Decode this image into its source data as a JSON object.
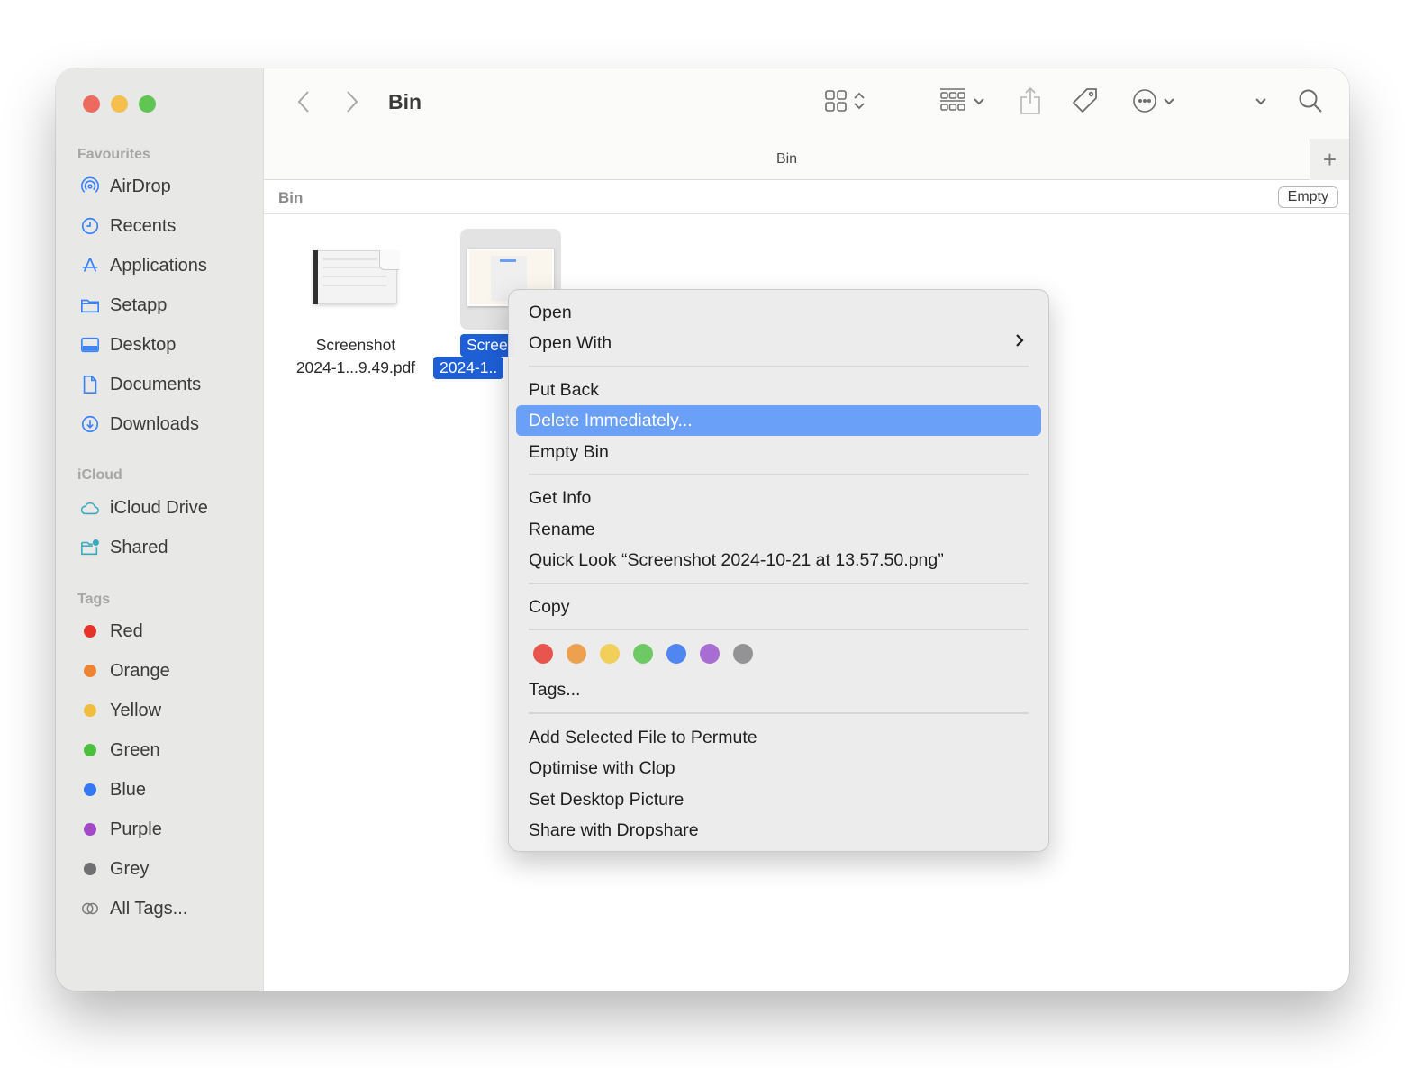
{
  "window": {
    "title": "Bin"
  },
  "sidebar": {
    "sections": [
      {
        "title": "Favourites"
      },
      {
        "title": "iCloud"
      },
      {
        "title": "Tags"
      }
    ],
    "favourites": [
      {
        "label": "AirDrop",
        "icon": "airdrop-icon"
      },
      {
        "label": "Recents",
        "icon": "clock-icon"
      },
      {
        "label": "Applications",
        "icon": "applications-icon"
      },
      {
        "label": "Setapp",
        "icon": "folder-icon"
      },
      {
        "label": "Desktop",
        "icon": "desktop-icon"
      },
      {
        "label": "Documents",
        "icon": "document-icon"
      },
      {
        "label": "Downloads",
        "icon": "download-icon"
      }
    ],
    "icloud": [
      {
        "label": "iCloud Drive",
        "icon": "cloud-icon"
      },
      {
        "label": "Shared",
        "icon": "shared-folder-icon"
      }
    ],
    "tags": [
      {
        "label": "Red",
        "color": "#e5332a"
      },
      {
        "label": "Orange",
        "color": "#ee8433"
      },
      {
        "label": "Yellow",
        "color": "#f0bd3e"
      },
      {
        "label": "Green",
        "color": "#4cbf3f"
      },
      {
        "label": "Blue",
        "color": "#3478f6"
      },
      {
        "label": "Purple",
        "color": "#a14ac8"
      },
      {
        "label": "Grey",
        "color": "#707074"
      },
      {
        "label": "All Tags...",
        "color": null
      }
    ]
  },
  "toolbar": {
    "title": "Bin",
    "icons": [
      "back-icon",
      "forward-icon",
      "icon-view-icon",
      "group-icon",
      "share-icon",
      "tag-icon",
      "more-icon",
      "expand-chevron-icon",
      "search-icon"
    ]
  },
  "tabbar": {
    "tab_label": "Bin",
    "add_tab": "+"
  },
  "pathbar": {
    "label": "Bin",
    "empty_button": "Empty"
  },
  "files": [
    {
      "line1": "Screenshot",
      "line2": "2024-1...9.49.pdf",
      "selected": false
    },
    {
      "line1": "Scree",
      "line2": "2024-1..",
      "selected": true
    }
  ],
  "context_menu": {
    "groups": [
      [
        {
          "label": "Open"
        },
        {
          "label": "Open With",
          "submenu": true
        }
      ],
      [
        {
          "label": "Put Back"
        },
        {
          "label": "Delete Immediately...",
          "highlighted": true
        },
        {
          "label": "Empty Bin"
        }
      ],
      [
        {
          "label": "Get Info"
        },
        {
          "label": "Rename"
        },
        {
          "label": "Quick Look “Screenshot 2024-10-21 at 13.57.50.png”"
        }
      ],
      [
        {
          "label": "Copy"
        }
      ],
      [
        {
          "label": "Tags..."
        }
      ],
      [
        {
          "label": "Add Selected File to Permute"
        },
        {
          "label": "Optimise with Clop"
        },
        {
          "label": "Set Desktop Picture"
        },
        {
          "label": "Share with Dropshare"
        }
      ]
    ],
    "tag_colors": [
      {
        "name": "red",
        "color": "#e8554c"
      },
      {
        "name": "orange",
        "color": "#eda04e"
      },
      {
        "name": "yellow",
        "color": "#f2cf5b"
      },
      {
        "name": "green",
        "color": "#6cc964"
      },
      {
        "name": "blue",
        "color": "#4f86ef"
      },
      {
        "name": "purple",
        "color": "#a86dd2"
      },
      {
        "name": "grey",
        "color": "#939396"
      }
    ],
    "submenu_glyph": "›"
  }
}
